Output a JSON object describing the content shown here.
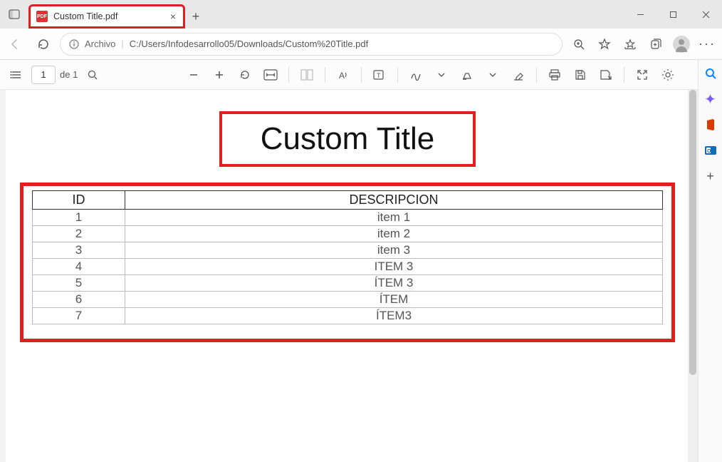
{
  "tab": {
    "title": "Custom Title.pdf",
    "favicon_label": "PDF"
  },
  "address": {
    "scheme_label": "Archivo",
    "path": "C:/Users/Infodesarrollo05/Downloads/Custom%20Title.pdf"
  },
  "pdf_toolbar": {
    "page_current": "1",
    "page_of_prefix": "de",
    "page_total": "1"
  },
  "document": {
    "title": "Custom Title",
    "columns": [
      "ID",
      "DESCRIPCION"
    ],
    "rows": [
      {
        "id": "1",
        "desc": "item 1"
      },
      {
        "id": "2",
        "desc": "item 2"
      },
      {
        "id": "3",
        "desc": "item 3"
      },
      {
        "id": "4",
        "desc": "ITEM 3"
      },
      {
        "id": "5",
        "desc": "ÍTEM 3"
      },
      {
        "id": "6",
        "desc": "ÍTEM"
      },
      {
        "id": "7",
        "desc": "ÍTEM3"
      }
    ]
  }
}
